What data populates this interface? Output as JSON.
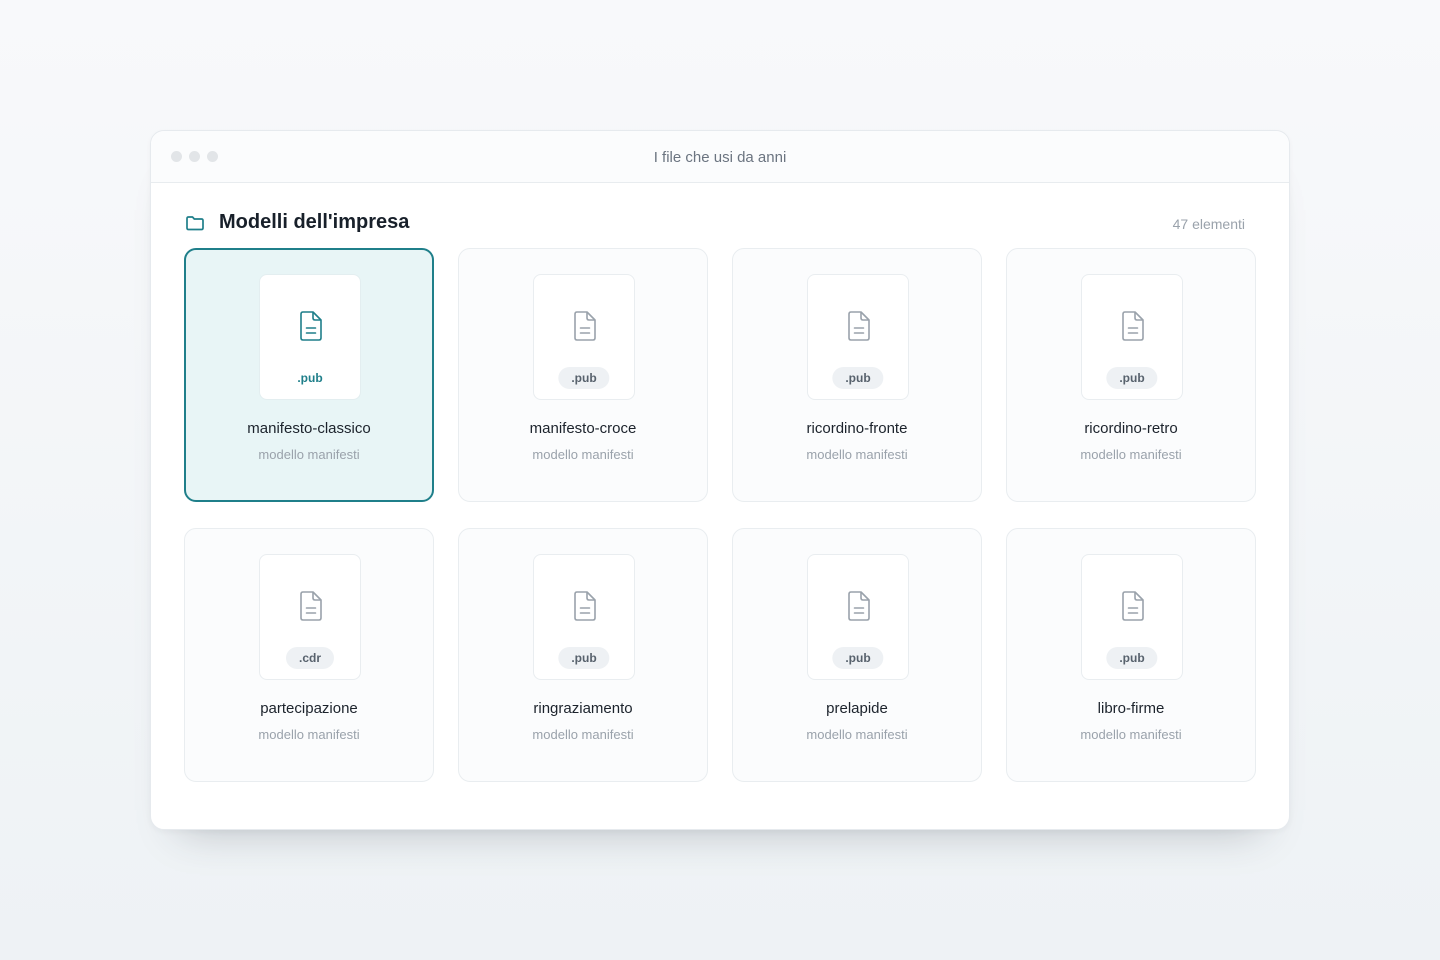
{
  "window": {
    "title": "I file che usi da anni"
  },
  "folder": {
    "title": "Modelli dell'impresa",
    "count": "47 elementi",
    "icon": "folder-icon",
    "accent": "#1f7f8a"
  },
  "files": [
    {
      "name": "manifesto-classico",
      "ext": ".pub",
      "subtitle": "modello manifesti",
      "selected": true
    },
    {
      "name": "manifesto-croce",
      "ext": ".pub",
      "subtitle": "modello manifesti"
    },
    {
      "name": "ricordino-fronte",
      "ext": ".pub",
      "subtitle": "modello manifesti"
    },
    {
      "name": "ricordino-retro",
      "ext": ".pub",
      "subtitle": "modello manifesti"
    },
    {
      "name": "partecipazione",
      "ext": ".cdr",
      "subtitle": "modello manifesti"
    },
    {
      "name": "ringraziamento",
      "ext": ".pub",
      "subtitle": "modello manifesti"
    },
    {
      "name": "prelapide",
      "ext": ".pub",
      "subtitle": "modello manifesti"
    },
    {
      "name": "libro-firme",
      "ext": ".pub",
      "subtitle": "modello manifesti"
    }
  ]
}
